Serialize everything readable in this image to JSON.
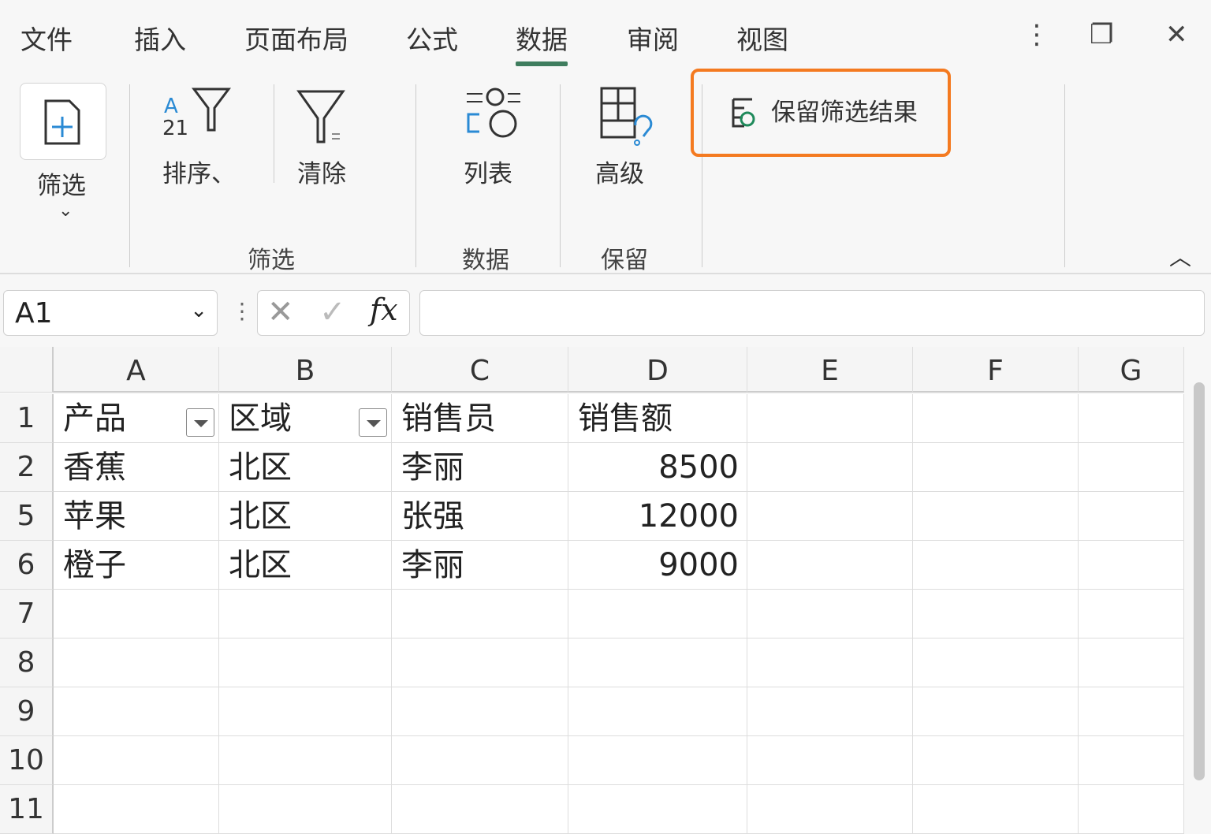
{
  "menu": {
    "tabs": [
      "文件",
      "插入",
      "页面布局",
      "公式",
      "数据",
      "审阅",
      "视图"
    ],
    "active": "数据"
  },
  "ribbon": {
    "filter": "筛选",
    "sort": "排序、",
    "clear": "清除",
    "list": "列表",
    "advanced": "高级",
    "keep": "保留筛选结果",
    "groups": [
      "筛选",
      "数据",
      "保留"
    ]
  },
  "formula": {
    "namebox": "A1",
    "fx": "fx",
    "value": ""
  },
  "columns": [
    "A",
    "B",
    "C",
    "D",
    "E",
    "F",
    "G"
  ],
  "rows": [
    {
      "n": "1",
      "cells": [
        "产品",
        "区域",
        "销售员",
        "销售额"
      ]
    },
    {
      "n": "2",
      "cells": [
        "香蕉",
        "北区",
        "李丽",
        "8500"
      ]
    },
    {
      "n": "5",
      "cells": [
        "苹果",
        "北区",
        "张强",
        "12000"
      ]
    },
    {
      "n": "6",
      "cells": [
        "橙子",
        "北区",
        "李丽",
        "9000"
      ]
    },
    {
      "n": "7",
      "cells": [
        "",
        "",
        "",
        ""
      ]
    },
    {
      "n": "8",
      "cells": [
        "",
        "",
        "",
        ""
      ]
    },
    {
      "n": "9",
      "cells": [
        "",
        "",
        "",
        ""
      ]
    },
    {
      "n": "10",
      "cells": [
        "",
        "",
        "",
        ""
      ]
    },
    {
      "n": "11",
      "cells": [
        "",
        "",
        "",
        ""
      ]
    }
  ],
  "accent": "#f47a20"
}
